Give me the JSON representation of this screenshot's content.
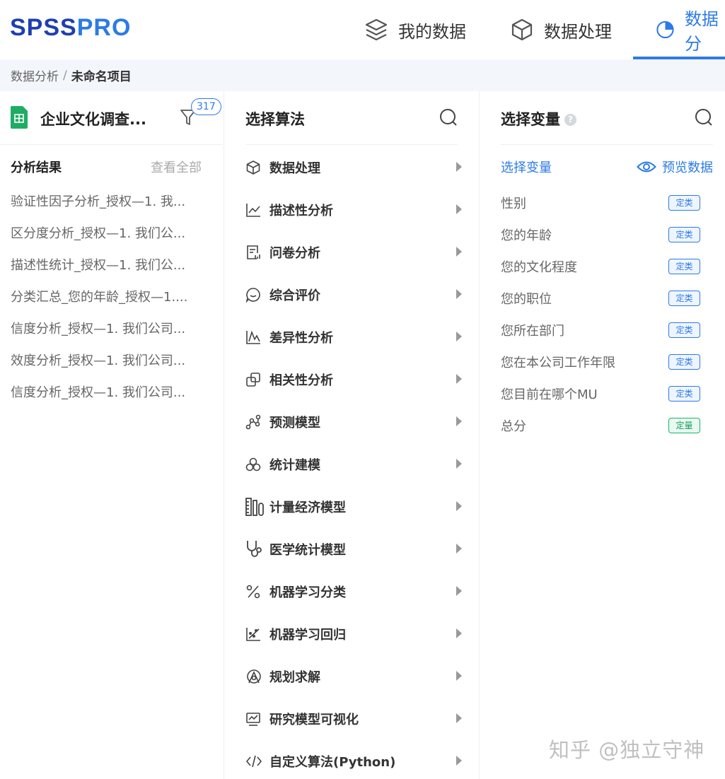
{
  "logo": {
    "part1": "SPSS",
    "part2": "PRO"
  },
  "nav": {
    "items": [
      {
        "label": "我的数据",
        "icon": "layers-icon"
      },
      {
        "label": "数据处理",
        "icon": "cube-icon"
      },
      {
        "label": "数据分",
        "icon": "pie-chart-icon",
        "active": true
      }
    ]
  },
  "breadcrumb": {
    "parent": "数据分析",
    "separator": "/",
    "current": "未命名项目"
  },
  "project": {
    "name": "企业文化调查...",
    "filter_count": "317"
  },
  "results": {
    "title": "分析结果",
    "view_all": "查看全部",
    "items": [
      "验证性因子分析_授权—1. 我...",
      "区分度分析_授权—1. 我们公...",
      "描述性统计_授权—1. 我们公...",
      "分类汇总_您的年龄_授权—1....",
      "信度分析_授权—1. 我们公司...",
      "效度分析_授权—1. 我们公司...",
      "信度分析_授权—1. 我们公司..."
    ]
  },
  "algorithms": {
    "title": "选择算法",
    "items": [
      {
        "label": "数据处理",
        "icon": "cube-icon"
      },
      {
        "label": "描述性分析",
        "icon": "line-chart-icon"
      },
      {
        "label": "问卷分析",
        "icon": "questionnaire-icon"
      },
      {
        "label": "综合评价",
        "icon": "chat-bubble-icon"
      },
      {
        "label": "差异性分析",
        "icon": "difference-icon"
      },
      {
        "label": "相关性分析",
        "icon": "overlap-squares-icon"
      },
      {
        "label": "预测模型",
        "icon": "node-graph-icon"
      },
      {
        "label": "统计建模",
        "icon": "circles-icon"
      },
      {
        "label": "计量经济模型",
        "icon": "ruler-columns-icon"
      },
      {
        "label": "医学统计模型",
        "icon": "stethoscope-icon"
      },
      {
        "label": "机器学习分类",
        "icon": "percent-icon"
      },
      {
        "label": "机器学习回归",
        "icon": "scatter-trend-icon"
      },
      {
        "label": "规划求解",
        "icon": "planning-icon"
      },
      {
        "label": "研究模型可视化",
        "icon": "monitor-chart-icon"
      },
      {
        "label": "自定义算法(Python)",
        "icon": "code-icon"
      }
    ]
  },
  "variables": {
    "title": "选择变量",
    "help": "?",
    "subtitle": "选择变量",
    "preview": "预览数据",
    "items": [
      {
        "name": "性别",
        "type": "定类"
      },
      {
        "name": "您的年龄",
        "type": "定类"
      },
      {
        "name": "您的文化程度",
        "type": "定类"
      },
      {
        "name": "您的职位",
        "type": "定类"
      },
      {
        "name": "您所在部门",
        "type": "定类"
      },
      {
        "name": "您在本公司工作年限",
        "type": "定类"
      },
      {
        "name": "您目前在哪个MU",
        "type": "定类"
      },
      {
        "name": "总分",
        "type": "定量"
      }
    ]
  },
  "watermark": "知乎 @独立守神",
  "colors": {
    "primary": "#2c7be5",
    "logo_dark": "#1f3fb0",
    "quantitative_tag": "#19b56e",
    "sheet_icon": "#1fad66"
  }
}
